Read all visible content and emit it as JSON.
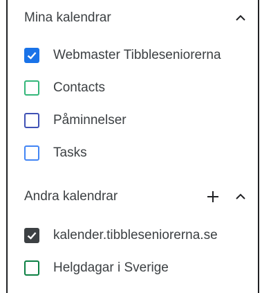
{
  "my_calendars": {
    "title": "Mina kalendrar",
    "collapse_icon": "chevron-up-icon",
    "items": [
      {
        "label": "Webmaster Tibbleseniorerna",
        "checked": true,
        "color": "#1a73e8"
      },
      {
        "label": "Contacts",
        "checked": false,
        "color": "#33b679"
      },
      {
        "label": "Påminnelser",
        "checked": false,
        "color": "#3f51b5"
      },
      {
        "label": "Tasks",
        "checked": false,
        "color": "#4285f4"
      }
    ]
  },
  "other_calendars": {
    "title": "Andra kalendrar",
    "add_icon": "plus-icon",
    "collapse_icon": "chevron-up-icon",
    "items": [
      {
        "label": "kalender.tibbleseniorerna.se",
        "checked": true,
        "color": "#3c4043"
      },
      {
        "label": "Helgdagar i Sverige",
        "checked": false,
        "color": "#0b8043"
      }
    ]
  }
}
